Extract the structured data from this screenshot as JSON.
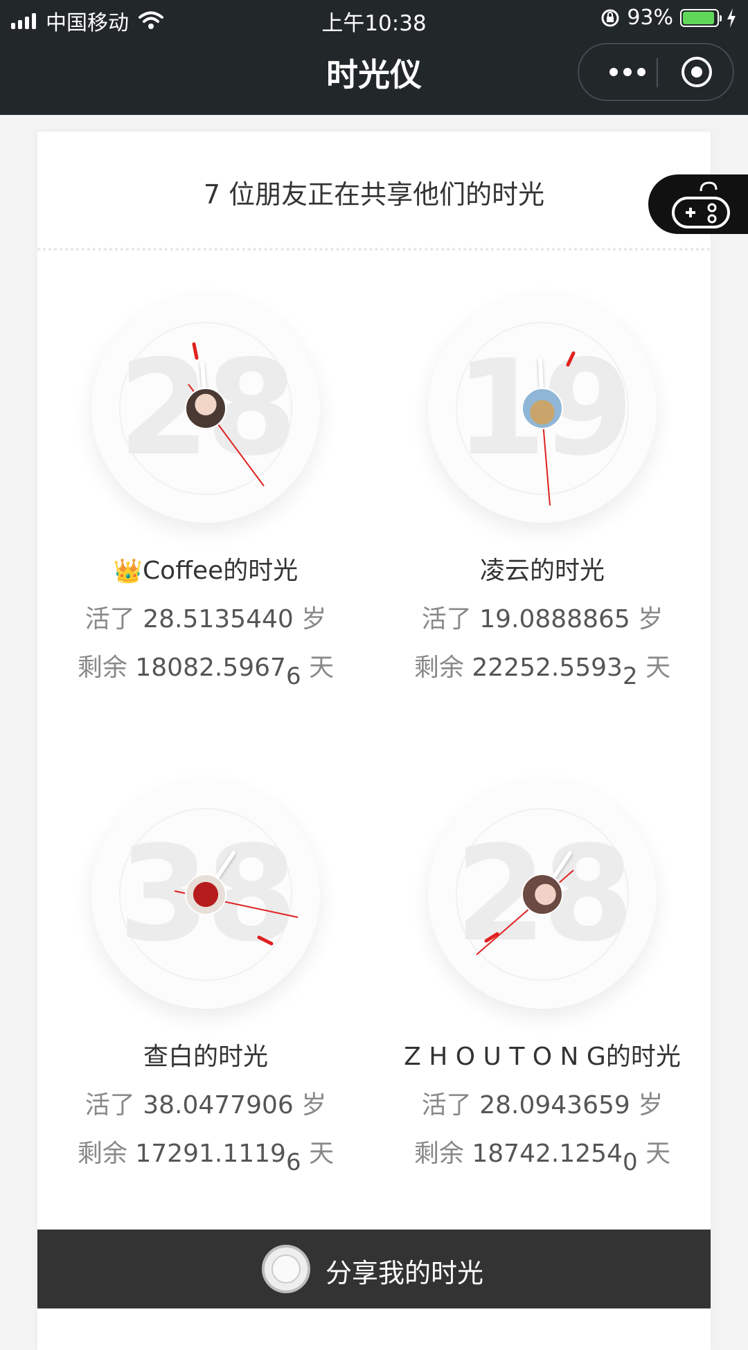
{
  "status_bar": {
    "carrier": "中国移动",
    "time": "上午10:38",
    "battery": "93%",
    "battery_level": 0.93
  },
  "nav": {
    "title": "时光仪",
    "more_icon": "more-dots-icon",
    "close_icon": "target-icon"
  },
  "header": {
    "text": "7 位朋友正在共享他们的时光"
  },
  "game_icon": "gamepad-icon",
  "friends": [
    {
      "big_number": "28",
      "crown": "👑",
      "name": "Coffee的时光",
      "lived_prefix": "活了",
      "lived": "28.5135440",
      "lived_unit": "岁",
      "remain_prefix": "剩余",
      "remain": "18082.5967",
      "remain_sub": "6",
      "remain_unit": "天",
      "avatar_color": "#7a5d4d"
    },
    {
      "big_number": "19",
      "crown": "",
      "name": "凌云的时光",
      "lived_prefix": "活了",
      "lived": "19.0888865",
      "lived_unit": "岁",
      "remain_prefix": "剩余",
      "remain": "22252.5593",
      "remain_sub": "2",
      "remain_unit": "天",
      "avatar_color": "#c9a56b"
    },
    {
      "big_number": "38",
      "crown": "",
      "name": "查白的时光",
      "lived_prefix": "活了",
      "lived": "38.0477906",
      "lived_unit": "岁",
      "remain_prefix": "剩余",
      "remain": "17291.1119",
      "remain_sub": "6",
      "remain_unit": "天",
      "avatar_color": "#b71c1c"
    },
    {
      "big_number": "28",
      "crown": "",
      "name": "Z H O U T O N G的时光",
      "lived_prefix": "活了",
      "lived": "28.0943659",
      "lived_unit": "岁",
      "remain_prefix": "剩余",
      "remain": "18742.1254",
      "remain_sub": "0",
      "remain_unit": "天",
      "avatar_color": "#d9b3a6"
    }
  ],
  "share": {
    "label": "分享我的时光",
    "icon": "clock-icon"
  },
  "colors": {
    "topbar": "#22272a",
    "accent_hand": "#e02020",
    "share_bar": "#333333"
  }
}
